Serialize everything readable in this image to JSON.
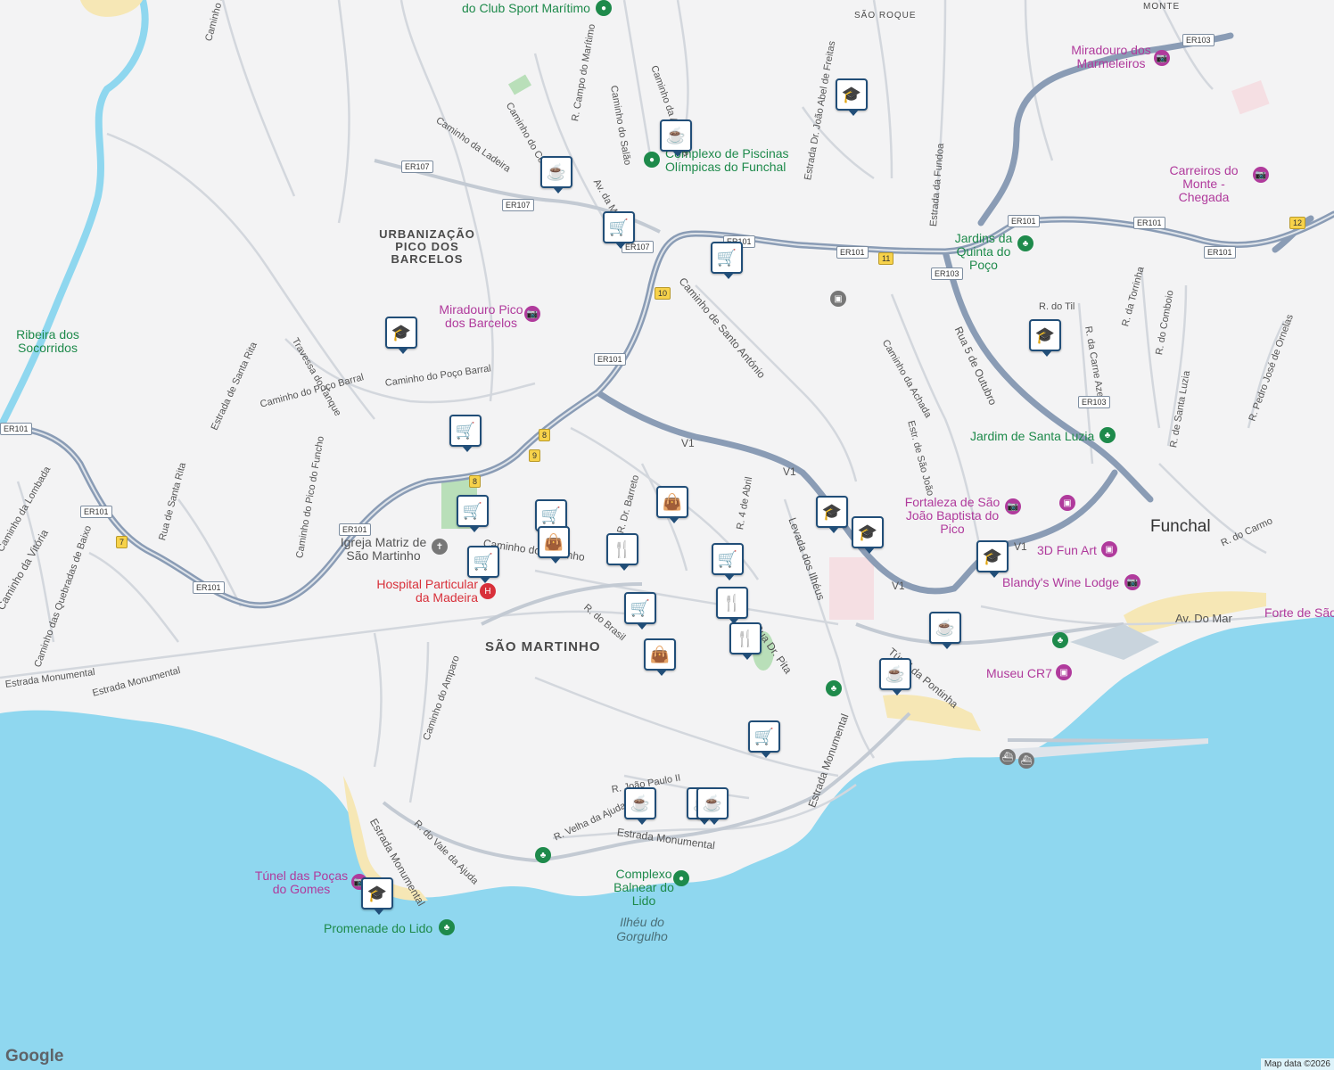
{
  "areas": {
    "pico_barcelos": "URBANIZAÇÃO PICO DOS BARCELOS",
    "sao_martinho": "SÃO MARTINHO",
    "sao_roque": "SÃO ROQUE",
    "monte": "MONTE"
  },
  "city": "Funchal",
  "sea_labels": {
    "ilheu": "Ilhéu do Gorgulho"
  },
  "pois": {
    "club": "do Club Sport Marítimo",
    "piscinas": "Complexo de Piscinas Olímpicas do Funchal",
    "miradouro_barcelos": "Miradouro Pico dos Barcelos",
    "ribeira": "Ribeira dos Socorridos",
    "igreja": "Igreja Matriz de São Martinho",
    "hospital": "Hospital Particular da Madeira",
    "marmeleiros": "Miradouro dos Marmeleiros",
    "carreiros": "Carreiros do Monte - Chegada",
    "jardins_poco": "Jardins da Quinta do Poço",
    "santa_luzia": "Jardim de Santa Luzia",
    "fortaleza": "Fortaleza de São João Baptista do Pico",
    "fun_art": "3D Fun Art",
    "blandy": "Blandy's Wine Lodge",
    "forte": "Forte de São",
    "museu": "Museu CR7",
    "tunel_pocas": "Túnel das Poças do Gomes",
    "promenade": "Promenade do Lido",
    "balnear": "Complexo Balnear do Lido"
  },
  "streets": {
    "s1": "Caminho do Tanque",
    "s2": "Caminho da Ladeira",
    "s3": "Caminho do Cemitério",
    "s4": "R. Campo do Marítimo",
    "s5": "Caminho do Salão",
    "s6": "Caminho da Azinhaga",
    "s7": "Av. da Madalena",
    "s8": "Caminho de Santo António",
    "s9": "Estrada Dr. João Abel de Freitas",
    "s10": "Estrada da Fundoa",
    "s11": "Rua 5 de Outubro",
    "s12": "R. do Til",
    "s13": "R. da Torrinha",
    "s14": "R. da Carne Azeda",
    "s15": "R. do Comboio",
    "s16": "R. de Santa Luzia",
    "s17": "R. Pedro José de Ornelas",
    "s18": "Caminho da Achada",
    "s19": "Estr. de São João",
    "s20": "Travessa do Tanque",
    "s21": "Estrada de Santa Rita",
    "s22": "Caminho do Poço Barral",
    "s23": "Caminho do Pico do Funcho",
    "s24": "Rua de Santa Rita",
    "s25": "Caminho da Lombada",
    "s26": "Caminho das Quebradas de Baixo",
    "s27": "Estrada Monumental",
    "s28": "Caminho do Amparo",
    "s29": "Caminho do Martinho",
    "s30": "R. Dr. Barreto",
    "s31": "R. 4 de Abril",
    "s32": "R. do Brasil",
    "s33": "Rua Dr. Pita",
    "s34": "Levada dos Ilhéus",
    "s35": "Túnel da Pontinha",
    "s36": "Av. Do Mar",
    "s37": "R. do Carmo",
    "s38": "R. do Vale da Ajuda",
    "s39": "R. Velha da Ajuda",
    "s40": "R. João Paulo II",
    "s41": "Caminho da Vitória",
    "s42": "Caminho do Tanque",
    "s43": "Estrada Monumental",
    "s44": "Estrada Monumental",
    "s45": "Estrada Monumental",
    "s46": "Estrada Monumental",
    "s47": "Caminho do Poço Barral"
  },
  "shields": {
    "er107a": "ER107",
    "er107b": "ER107",
    "er107c": "ER107",
    "er101a": "ER101",
    "er101b": "ER101",
    "er101c": "ER101",
    "er101d": "ER101",
    "er101e": "ER101",
    "er101f": "ER101",
    "er101g": "ER101",
    "er101h": "ER101",
    "er101i": "ER101",
    "er101j": "ER101",
    "er103a": "ER103",
    "er103b": "ER103",
    "er103c": "ER103",
    "v1a": "V1",
    "v1b": "V1",
    "v1c": "V1",
    "v1d": "V1",
    "n10": "10",
    "n11": "11",
    "n8": "8",
    "n9": "9",
    "n8b": "8",
    "n7": "7",
    "n12": "12"
  },
  "icons": {
    "cafe": "☕",
    "cart": "🛒",
    "school": "🎓",
    "bag": "👜",
    "food": "🍴",
    "dot_pin": "●",
    "camera": "📷",
    "tree": "♣",
    "cross": "✝",
    "hospital": "H",
    "museum": "▣",
    "ferry": "⛴"
  },
  "google": "Google",
  "attribution": "Map data ©2026",
  "colors": {
    "sea": "#8fd7ef",
    "motorway": "#8a9cb5",
    "land": "#f3f3f4",
    "road": "#d3d7dd",
    "marker": "#214e78"
  }
}
